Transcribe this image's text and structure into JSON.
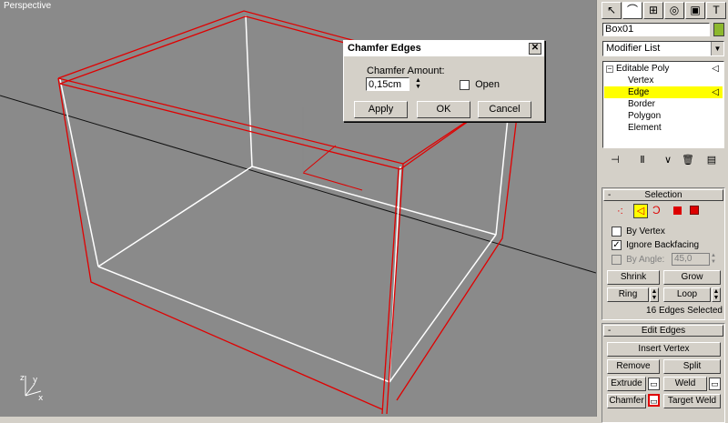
{
  "viewport": {
    "label": "Perspective"
  },
  "dialog": {
    "title": "Chamfer Edges",
    "close_glyph": "✕",
    "amount_label": "Chamfer Amount:",
    "amount_value": "0,15cm",
    "open_label": "Open",
    "open_checked": false,
    "apply_label": "Apply",
    "ok_label": "OK",
    "cancel_label": "Cancel"
  },
  "panel": {
    "object_name": "Box01",
    "object_color": "#8db82d",
    "modifier_list_label": "Modifier List",
    "stack": {
      "root": "Editable Poly",
      "items": [
        "Vertex",
        "Edge",
        "Border",
        "Polygon",
        "Element"
      ],
      "selected": "Edge"
    },
    "selection": {
      "title": "Selection",
      "by_vertex": "By Vertex",
      "by_vertex_checked": false,
      "ignore_backfacing": "Ignore Backfacing",
      "ignore_backfacing_checked": true,
      "by_angle": "By Angle:",
      "by_angle_checked": false,
      "angle_value": "45,0",
      "shrink": "Shrink",
      "grow": "Grow",
      "ring": "Ring",
      "loop": "Loop",
      "status": "16 Edges Selected"
    },
    "edit_edges": {
      "title": "Edit Edges",
      "insert_vertex": "Insert Vertex",
      "remove": "Remove",
      "split": "Split",
      "extrude": "Extrude",
      "weld": "Weld",
      "chamfer": "Chamfer",
      "target_weld": "Target Weld"
    }
  },
  "colors": {
    "viewport_bg": "#8a8a8a",
    "selected_edge": "#e00000",
    "edge": "#ffffff",
    "highlight": "#ffff00"
  }
}
